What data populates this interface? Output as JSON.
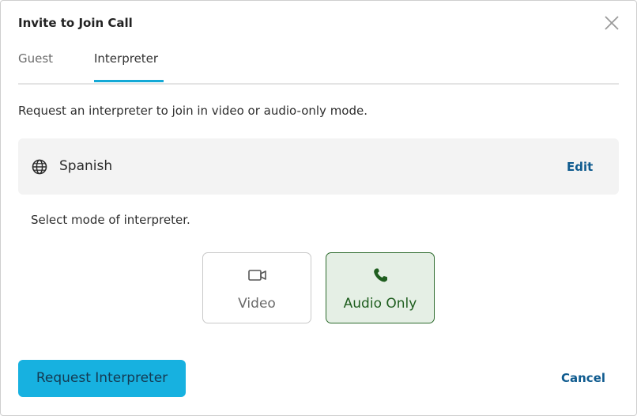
{
  "dialog": {
    "title": "Invite to Join Call",
    "close_icon": "close-icon"
  },
  "tabs": [
    {
      "label": "Guest",
      "active": false
    },
    {
      "label": "Interpreter",
      "active": true
    }
  ],
  "main": {
    "description": "Request an interpreter to join in video or audio-only mode.",
    "language": {
      "icon": "globe-icon",
      "name": "Spanish",
      "edit_label": "Edit"
    },
    "mode_prompt": "Select mode of interpreter.",
    "modes": [
      {
        "label": "Video",
        "icon": "video-camera-icon",
        "selected": false
      },
      {
        "label": "Audio Only",
        "icon": "phone-icon",
        "selected": true
      }
    ]
  },
  "footer": {
    "request_label": "Request Interpreter",
    "cancel_label": "Cancel"
  },
  "colors": {
    "accent": "#17b1e0",
    "tab_underline": "#14a9d6",
    "link": "#0f5b8f",
    "selected_border": "#2e6b2e",
    "selected_bg": "#e5efe5",
    "selected_text": "#1f5e1f"
  }
}
